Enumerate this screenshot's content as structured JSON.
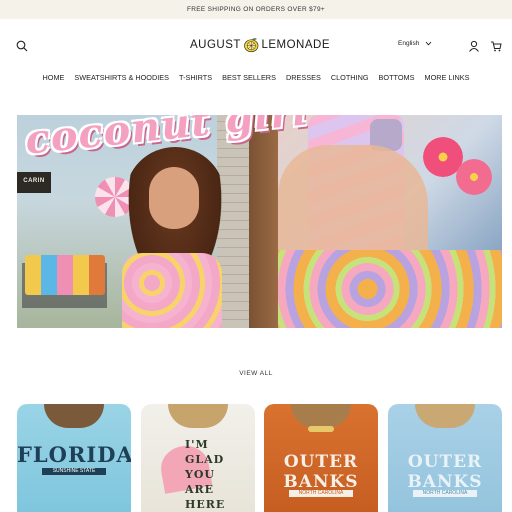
{
  "announcement": {
    "text": "FREE SHIPPING ON ORDERS OVER $79+"
  },
  "header": {
    "logo_left": "AUGUST",
    "logo_right": "LEMONADE",
    "language": "English"
  },
  "icons": {
    "search": "search-icon",
    "account": "account-icon",
    "cart": "cart-icon",
    "logo": "lemon-icon",
    "chevron": "chevron-down-icon"
  },
  "nav": {
    "items": [
      {
        "label": "HOME"
      },
      {
        "label": "SWEATSHIRTS & HOODIES"
      },
      {
        "label": "T-SHIRTS"
      },
      {
        "label": "BEST SELLERS"
      },
      {
        "label": "DRESSES"
      },
      {
        "label": "CLOTHING"
      },
      {
        "label": "BOTTOMS"
      },
      {
        "label": "MORE LINKS"
      }
    ]
  },
  "hero": {
    "headline": "coconut girl",
    "patch_label": "CARIN"
  },
  "collection": {
    "view_all_label": "VIEW ALL"
  },
  "products": [
    {
      "graphic_text": "FLORIDA",
      "graphic_sub": "SUNSHINE STATE"
    },
    {
      "graphic_text": "I'M GLAD YOU ARE HERE"
    },
    {
      "graphic_text": "OUTER BANKS",
      "graphic_sub": "NORTH CAROLINA"
    },
    {
      "graphic_text": "OUTER BANKS",
      "graphic_sub": "NORTH CAROLINA"
    }
  ],
  "colors": {
    "announcement_bg": "#f5f2ea",
    "text": "#1a1a1a",
    "hero_pink": "#f4a0c0",
    "lemon": "#f6d23a"
  }
}
